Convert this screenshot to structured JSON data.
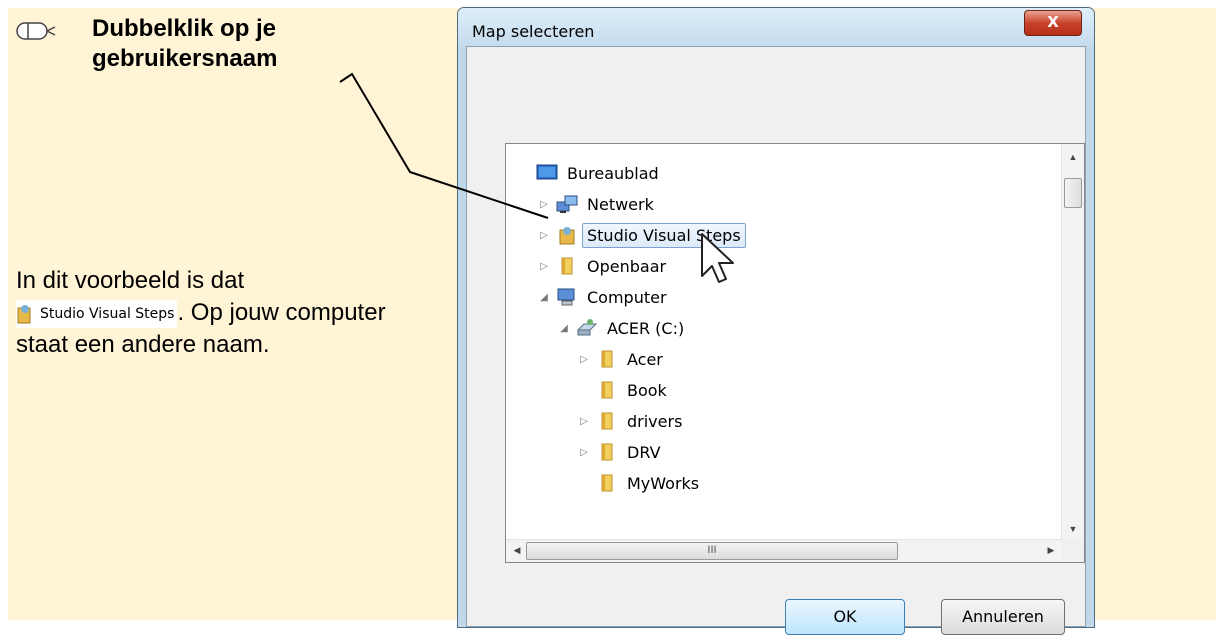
{
  "instruction": {
    "icon": "mouse-double-click-icon",
    "text_line1": "Dubbelklik op je",
    "text_line2": "gebruikersnaam"
  },
  "explanation": {
    "prefix": "In dit voorbeeld is dat",
    "inline_item": "Studio Visual Steps",
    "suffix": ". Op jouw computer staat een andere naam."
  },
  "dialog": {
    "title": "Map selecteren",
    "close_label": "X",
    "tree": [
      {
        "label": "Bureaublad",
        "icon": "desktop-icon",
        "expander": ""
      },
      {
        "label": "Netwerk",
        "icon": "network-icon",
        "expander": "▷"
      },
      {
        "label": "Studio Visual Steps",
        "icon": "user-folder-icon",
        "expander": "▷",
        "selected": true
      },
      {
        "label": "Openbaar",
        "icon": "folder-icon",
        "expander": "▷"
      },
      {
        "label": "Computer",
        "icon": "computer-icon",
        "expander": "◢"
      },
      {
        "label": "ACER (C:)",
        "icon": "drive-icon",
        "expander": "◢"
      },
      {
        "label": "Acer",
        "icon": "folder-icon",
        "expander": "▷"
      },
      {
        "label": "Book",
        "icon": "folder-icon",
        "expander": ""
      },
      {
        "label": "drivers",
        "icon": "folder-icon",
        "expander": "▷"
      },
      {
        "label": "DRV",
        "icon": "folder-icon",
        "expander": "▷"
      },
      {
        "label": "MyWorks",
        "icon": "folder-icon",
        "expander": ""
      }
    ],
    "ok_label": "OK",
    "cancel_label": "Annuleren",
    "hscroll_grip": "III"
  }
}
